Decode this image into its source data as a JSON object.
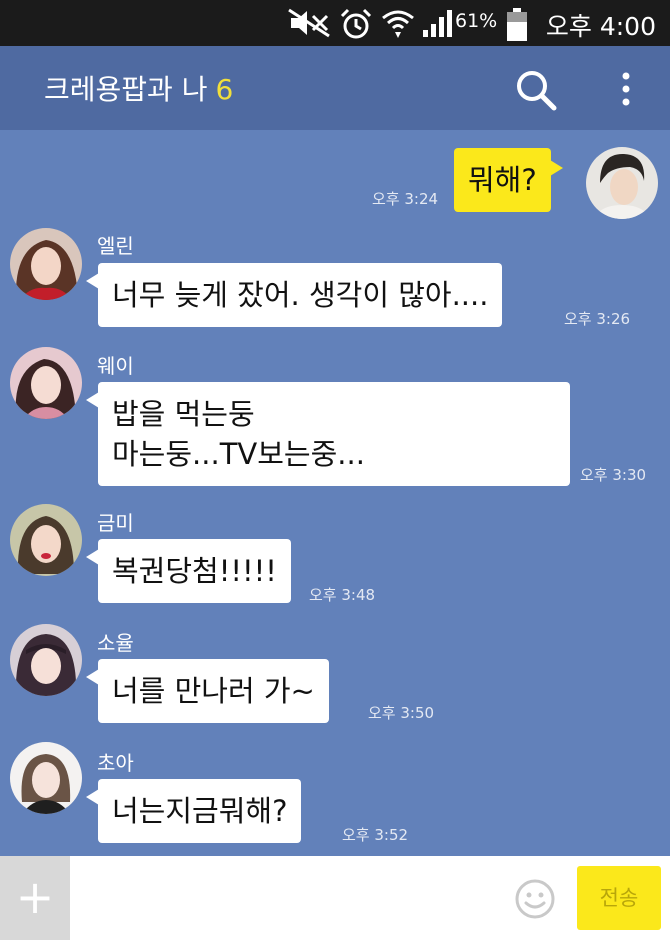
{
  "status_bar": {
    "battery_percent": "61%",
    "time": "오후 4:00",
    "icons": [
      "mute-icon",
      "alarm-icon",
      "wifi-icon",
      "signal-icon",
      "battery-icon"
    ]
  },
  "header": {
    "title": "크레용팝과 나",
    "member_count": "6",
    "icons": [
      "search-icon",
      "more-vertical-icon"
    ]
  },
  "messages": [
    {
      "direction": "out",
      "sender": "",
      "lines": [
        "뭐해?"
      ],
      "time": "오후 3:24",
      "avatar": "avatar-me"
    },
    {
      "direction": "in",
      "sender": "엘린",
      "lines": [
        "너무 늦게 잤어. 생각이 많아...."
      ],
      "time": "오후 3:26",
      "avatar": "avatar-ellin"
    },
    {
      "direction": "in",
      "sender": "웨이",
      "lines": [
        "밥을 먹는둥",
        "마는둥...TV보는중..."
      ],
      "time": "오후 3:30",
      "avatar": "avatar-way"
    },
    {
      "direction": "in",
      "sender": "금미",
      "lines": [
        "복권당첨!!!!!"
      ],
      "time": "오후 3:48",
      "avatar": "avatar-geummi"
    },
    {
      "direction": "in",
      "sender": "소율",
      "lines": [
        "너를 만나러 가~"
      ],
      "time": "오후 3:50",
      "avatar": "avatar-soyul"
    },
    {
      "direction": "in",
      "sender": "초아",
      "lines": [
        "너는지금뭐해?"
      ],
      "time": "오후 3:52",
      "avatar": "avatar-choa"
    }
  ],
  "input_bar": {
    "plus_label": "+",
    "input_value": "",
    "send_label": "전송",
    "icons": [
      "plus-icon",
      "emoji-icon"
    ]
  },
  "colors": {
    "chat_background": "#6281ba",
    "header_background": "#4f6aa1",
    "status_bar_background": "#1b1b1b",
    "own_bubble": "#fbe81b",
    "other_bubble": "#ffffff",
    "member_count": "#f2df3b",
    "send_button": "#fbe81b"
  }
}
